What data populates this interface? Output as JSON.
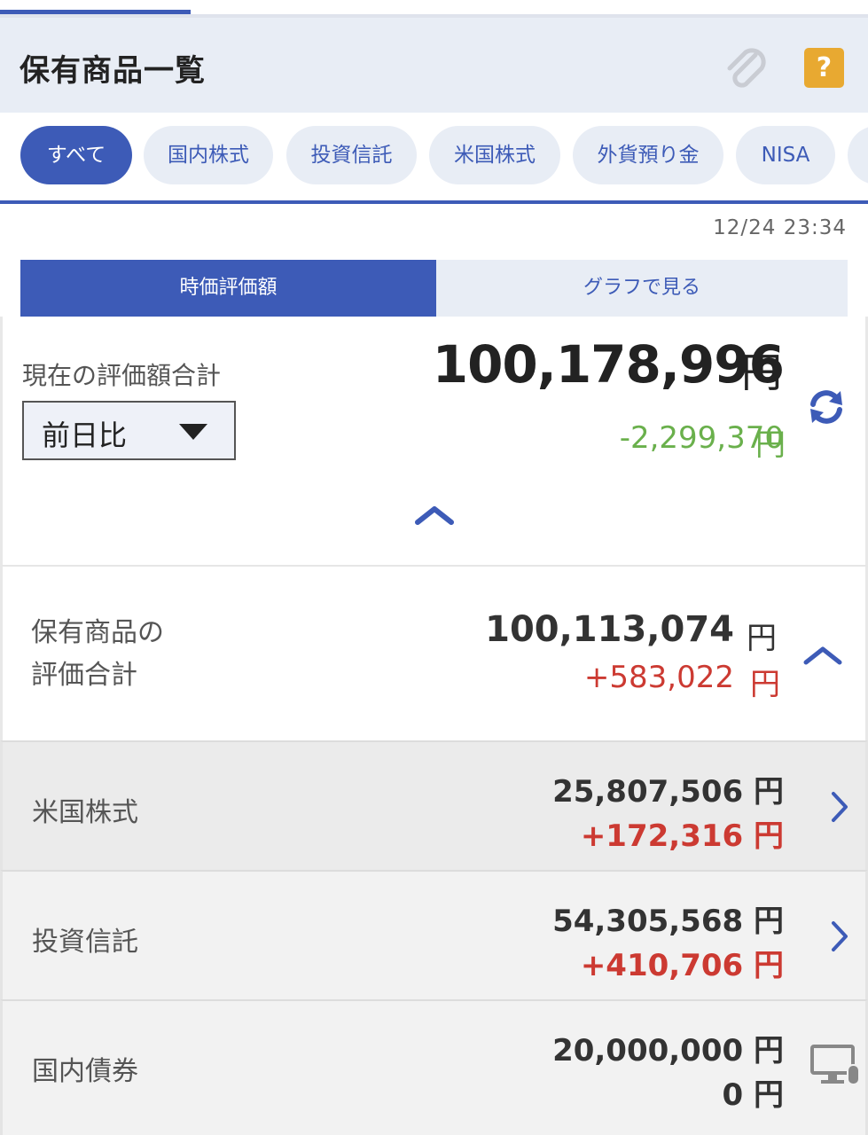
{
  "header": {
    "title": "保有商品一覧"
  },
  "tabs": [
    {
      "label": "すべて",
      "active": true
    },
    {
      "label": "国内株式",
      "active": false
    },
    {
      "label": "投資信託",
      "active": false
    },
    {
      "label": "米国株式",
      "active": false
    },
    {
      "label": "外貨預り金",
      "active": false
    },
    {
      "label": "NISA",
      "active": false
    }
  ],
  "timestamp": "12/24 23:34",
  "segment": {
    "active_label": "時価評価額",
    "inactive_label": "グラフで見る"
  },
  "total": {
    "label": "現在の評価額合計",
    "value": "100,178,996",
    "unit": "円",
    "change": "-2,299,370",
    "change_unit": "円",
    "compare_select": "前日比"
  },
  "holdings_total": {
    "label_line1": "保有商品の",
    "label_line2": "評価合計",
    "value": "100,113,074",
    "unit": "円",
    "change": "+583,022",
    "change_unit": "円"
  },
  "categories": [
    {
      "label": "米国株式",
      "value": "25,807,506 円",
      "change": "+172,316 円"
    },
    {
      "label": "投資信託",
      "value": "54,305,568 円",
      "change": "+410,706 円"
    },
    {
      "label": "国内債券",
      "value": "20,000,000 円",
      "change": "0 円"
    }
  ],
  "colors": {
    "accent": "#3d5bb7",
    "positive": "#cc3a32",
    "negative": "#6ab04c",
    "help": "#e8a931"
  },
  "icons": [
    "paperclip-icon",
    "help-icon",
    "refresh-icon",
    "chevron-up-icon",
    "chevron-right-icon",
    "pc-icon"
  ]
}
